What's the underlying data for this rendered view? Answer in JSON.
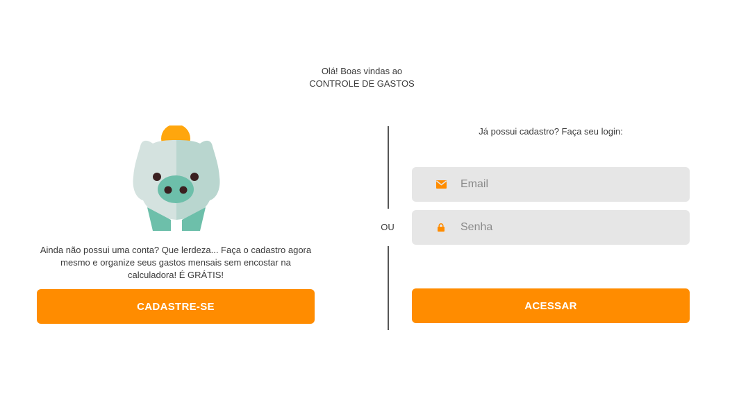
{
  "header": {
    "greeting_line1": "Olá! Boas vindas ao",
    "greeting_line2": "CONTROLE DE GASTOS"
  },
  "signup": {
    "illustration": "piggy-bank-icon",
    "text": "Ainda não possui uma conta? Que lerdeza... Faça o cadastro agora mesmo e organize seus gastos mensais sem encostar na calculadora! É GRÁTIS!",
    "button_label": "CADASTRE-SE"
  },
  "divider": {
    "label": "OU"
  },
  "login": {
    "prompt": "Já possui cadastro? Faça seu login:",
    "email_placeholder": "Email",
    "email_icon": "envelope-icon",
    "password_placeholder": "Senha",
    "password_icon": "lock-icon",
    "button_label": "ACESSAR"
  },
  "colors": {
    "accent": "#ff8c00",
    "input_bg": "#e6e6e6",
    "pig_light": "#d4e2df",
    "pig_shade": "#b9d6cf",
    "pig_snout": "#6dbfaa",
    "coin": "#ffa60d"
  }
}
